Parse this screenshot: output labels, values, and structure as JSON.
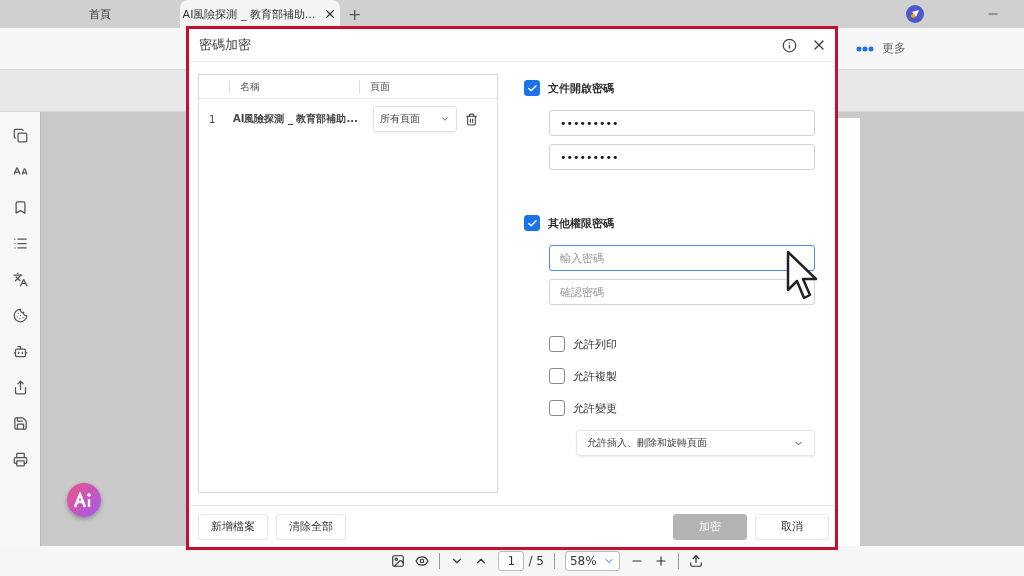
{
  "tabs": [
    {
      "label": "首頁",
      "selected": false
    },
    {
      "label": "AI風險探測 _ 教育部補助...",
      "selected": true
    }
  ],
  "new_tab": "+",
  "toolbar": {
    "more": "更多"
  },
  "dialog": {
    "title": "密碼加密",
    "table": {
      "columns": [
        "名稱",
        "頁面"
      ],
      "rows": [
        {
          "index": "1",
          "name": "AI風險探測 _ 教育部補助...",
          "pages": "所有頁面"
        }
      ]
    },
    "open_password": {
      "label": "文件開啟密碼",
      "checked": true,
      "password": "•••••••••",
      "confirm": "•••••••••"
    },
    "permission_password": {
      "label": "其他權限密碼",
      "checked": true,
      "placeholder": "輸入密碼",
      "confirm_placeholder": "確認密碼",
      "focused": true
    },
    "permissions": [
      {
        "label": "允許列印",
        "checked": false
      },
      {
        "label": "允許複製",
        "checked": false
      },
      {
        "label": "允許變更",
        "checked": false
      }
    ],
    "change_option": "允許插入、刪除和旋轉頁面",
    "add_button": "新增檔案",
    "clear_button": "清除全部",
    "encrypt_button": {
      "label": "加密",
      "disabled": true
    },
    "cancel_button": "取消"
  },
  "status_bar": {
    "page": "1",
    "total": "/ 5",
    "zoom": "58%"
  }
}
